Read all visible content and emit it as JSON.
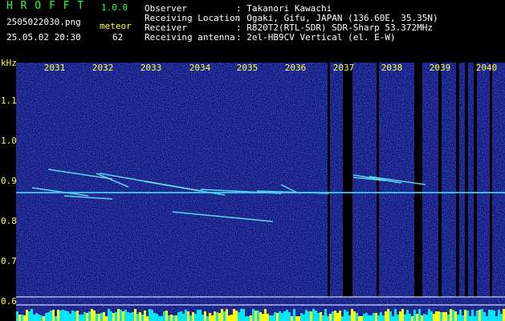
{
  "app": {
    "name": "H R O F F T",
    "version": "1.0.0"
  },
  "file": {
    "filename": "2505022030.png",
    "datetime": "25.05.02 20:30",
    "meteor_label": "meteor",
    "meteor_count": "62"
  },
  "station": {
    "observer_label": "Observer",
    "observer_value": ": Takanori Kawachi",
    "location_label": "Receiving Location",
    "location_value": ": Ogaki, Gifu, JAPAN (136.60E, 35.35N)",
    "receiver_label": "Receiver",
    "receiver_value": ": R820T2(RTL-SDR) SDR-Sharp 53.372MHz",
    "antenna_label": "Receiving antenna",
    "antenna_value": ": 2el-HB9CV Vertical (el. E-W)"
  },
  "spectrogram": {
    "y_unit": "kHz",
    "y_ticks": [
      "1.1",
      "1.0",
      "0.9",
      "0.8",
      "0.7",
      "0.6"
    ],
    "x_ticks": [
      "2031",
      "2032",
      "2033",
      "2034",
      "2035",
      "2036",
      "2037",
      "2038",
      "2039",
      "2040"
    ],
    "colors": {
      "background": "#0a0f6e",
      "carrier": "#3fd6ff",
      "meteor": "#6ff0ff",
      "gap": "#000000",
      "hlines": "#ffffff",
      "bottom_bars_a": "#00e6ff",
      "bottom_bars_b": "#ffff00"
    }
  }
}
